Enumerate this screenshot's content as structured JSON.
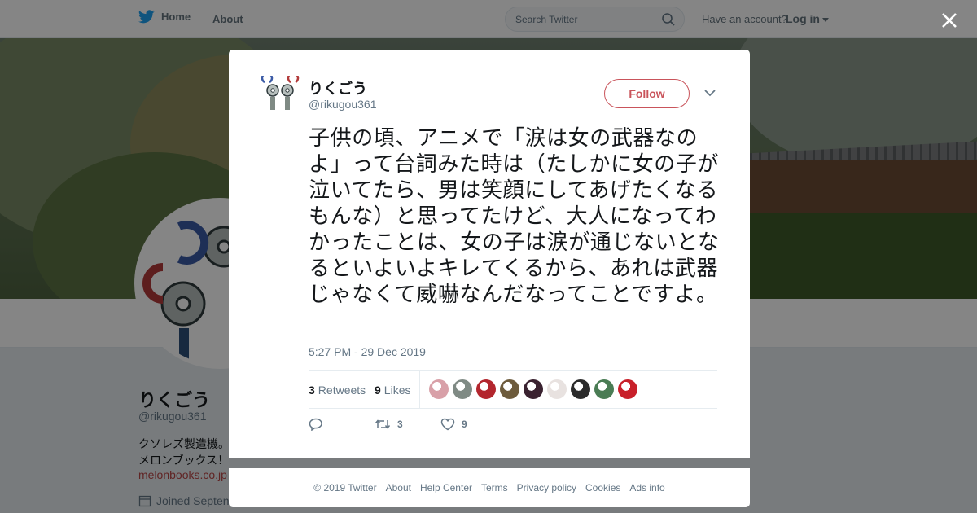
{
  "topbar": {
    "home_label": "Home",
    "about_label": "About",
    "search_placeholder": "Search Twitter",
    "account_prompt": "Have an account?",
    "login_label": "Log in"
  },
  "profile": {
    "name": "りくごう",
    "handle": "@rikugou361",
    "bio": "クソレズ製造機。 ごう堂）の通販・新刊はメロンブックス！",
    "link": "melonbooks.co.jp",
    "joined": "Joined Septen"
  },
  "tweet": {
    "author_name": "りくごう",
    "author_handle": "@rikugou361",
    "follow_label": "Follow",
    "text": "子供の頃、アニメで「涙は女の武器なのよ」って台詞みた時は（たしかに女の子が泣いてたら、男は笑顔にしてあげたくなるもんな）と思ってたけど、大人になってわかったことは、女の子は涙が通じないとなるといよいよキレてくるから、あれは武器じゃなくて威嚇なんだなってことですよ。",
    "timestamp": "5:27 PM - 29 Dec 2019",
    "retweets_count": "3",
    "retweets_label": "Retweets",
    "likes_count": "9",
    "likes_label": "Likes",
    "action_retweet_count": "3",
    "action_like_count": "9",
    "liker_colors": [
      "#d8a0a8",
      "#7f8a84",
      "#b3262e",
      "#6d5b3c",
      "#3a2230",
      "#e8e2e0",
      "#2b2b2b",
      "#4a7c54",
      "#c8202a"
    ]
  },
  "footer": {
    "links": [
      "© 2019 Twitter",
      "About",
      "Help Center",
      "Terms",
      "Privacy policy",
      "Cookies",
      "Ads info"
    ]
  },
  "colors": {
    "accent": "#c9545b",
    "twitter_blue": "#1da1f2",
    "muted": "#657786"
  }
}
